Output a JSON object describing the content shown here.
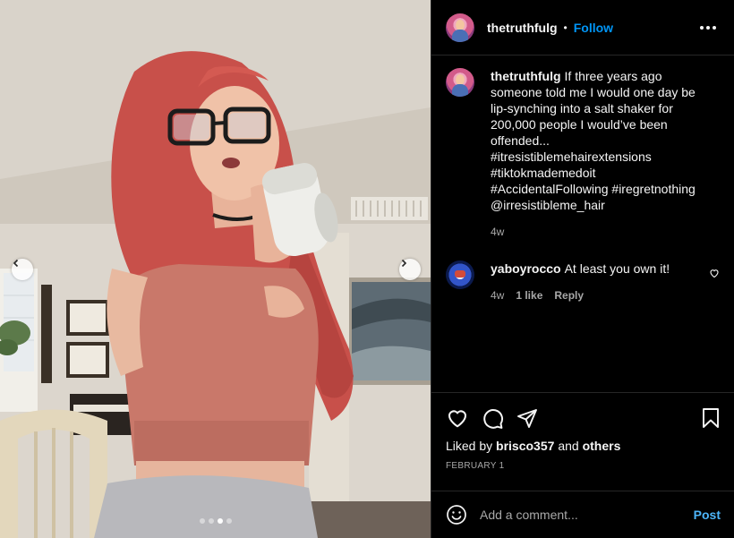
{
  "post": {
    "username": "thetruthfulg",
    "separator": "•",
    "follow_label": "Follow",
    "caption": "If three years ago someone told me I would one day be lip-synching into a salt shaker for 200,000 people I would’ve been offended... #itresistiblemehairextensions #tiktokmademedoit #AccidentalFollowing #iregretnothing @irresistibleme_hair",
    "caption_age": "4w",
    "media": {
      "slide_count": 4,
      "active_slide": 3,
      "prev_icon": "chevron-left-icon",
      "next_icon": "chevron-right-icon"
    }
  },
  "comments": [
    {
      "username": "yaboyrocco",
      "text": "At least you own it!",
      "age": "4w",
      "likes": "1 like",
      "reply_label": "Reply"
    }
  ],
  "actions": {
    "icons": [
      "heart-icon",
      "comment-icon",
      "share-icon",
      "bookmark-icon"
    ],
    "liked_by_prefix": "Liked by",
    "liked_by_user": "brisco357",
    "liked_by_and": "and",
    "liked_by_others": "others",
    "date": "FEBRUARY 1"
  },
  "add_comment": {
    "placeholder": "Add a comment...",
    "post_label": "Post"
  },
  "colors": {
    "background": "#000000",
    "text": "#f5f5f5",
    "muted": "#a8a8a8",
    "accent": "#0095f6",
    "divider": "#262626"
  }
}
